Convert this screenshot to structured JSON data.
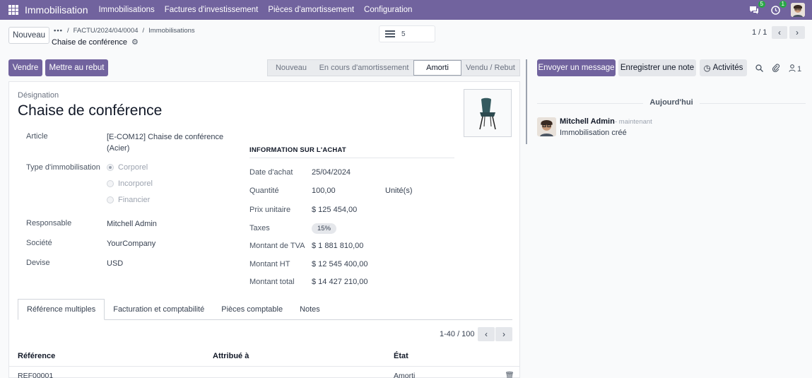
{
  "topbar": {
    "app_name": "Immobilisation",
    "menu": [
      "Immobilisations",
      "Factures d'investissement",
      "Pièces d'amortissement",
      "Configuration"
    ],
    "chat_badge": "5",
    "activity_badge": "1"
  },
  "control": {
    "new_button": "Nouveau",
    "breadcrumb_dots": "•••",
    "breadcrumb_items": [
      "FACTU/2024/04/0004",
      "Immobilisations"
    ],
    "record_name": "Chaise de conférence",
    "search_count": "5",
    "pager": "1 / 1"
  },
  "actions": {
    "sell": "Vendre",
    "scrap": "Mettre au rebut"
  },
  "statusbar": {
    "stages": [
      "Nouveau",
      "En cours d'amortissement",
      "Amorti",
      "Vendu / Rebut"
    ],
    "active": "Amorti"
  },
  "form": {
    "designation_label": "Désignation",
    "title": "Chaise de conférence",
    "article_label": "Article",
    "article_value_line1": "[E-COM12] Chaise de conférence",
    "article_value_line2": "(Acier)",
    "type_label": "Type d'immobilisation",
    "type_options": [
      "Corporel",
      "Incorporel",
      "Financier"
    ],
    "type_selected": "Corporel",
    "responsible_label": "Responsable",
    "responsible_value": "Mitchell Admin",
    "company_label": "Société",
    "company_value": "YourCompany",
    "currency_label": "Devise",
    "currency_value": "USD",
    "purchase_section": "INFORMATION SUR L'ACHAT",
    "purchase_date_label": "Date d'achat",
    "purchase_date": "25/04/2024",
    "quantity_label": "Quantité",
    "quantity": "100,00",
    "unit": "Unité(s)",
    "unit_price_label": "Prix unitaire",
    "unit_price": "$ 125 454,00",
    "taxes_label": "Taxes",
    "taxes": "15%",
    "vat_label": "Montant de TVA",
    "vat": "$ 1 881 810,00",
    "untaxed_label": "Montant HT",
    "untaxed": "$ 12 545 400,00",
    "total_label": "Montant total",
    "total": "$ 14 427 210,00"
  },
  "tabs": [
    "Référence multiples",
    "Facturation et comptabilité",
    "Pièces comptable",
    "Notes"
  ],
  "list": {
    "pager": "1-40 / 100",
    "columns": [
      "Référence",
      "Attribué à",
      "État"
    ],
    "rows": [
      {
        "reference": "REF00001",
        "assigned": "",
        "state": "Amorti"
      }
    ]
  },
  "chatter": {
    "send_message": "Envoyer un message",
    "log_note": "Enregistrer une note",
    "activities": "Activités",
    "followers_count": "1",
    "today": "Aujourd'hui",
    "author": "Mitchell Admin",
    "time": "- maintenant",
    "body": "Immobilisation créé"
  }
}
